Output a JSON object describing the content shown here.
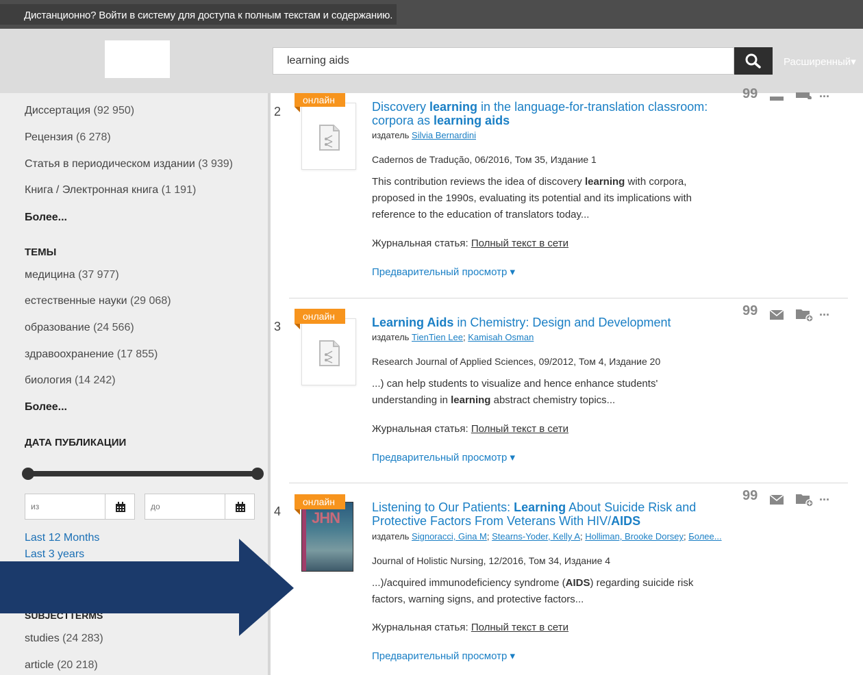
{
  "topbar": {
    "message": "Дистанционно? Войти в систему для доступа к полным текстам и содержанию."
  },
  "search": {
    "value": "learning aids",
    "advanced_label": "Расширенный"
  },
  "sidebar": {
    "content_types": [
      {
        "label": "Диссертация",
        "count": "(92 950)"
      },
      {
        "label": "Рецензия",
        "count": "(6 278)"
      },
      {
        "label": "Статья в периодическом издании",
        "count": "(3 939)"
      },
      {
        "label": "Книга / Электронная книга",
        "count": "(1 191)"
      }
    ],
    "more_1": "Более...",
    "topics_title": "ТЕМЫ",
    "topics": [
      {
        "label": "медицина",
        "count": "(37 977)"
      },
      {
        "label": "естественные науки",
        "count": "(29 068)"
      },
      {
        "label": "образование",
        "count": "(24 566)"
      },
      {
        "label": "здравоохранение",
        "count": "(17 855)"
      },
      {
        "label": "биология",
        "count": "(14 242)"
      }
    ],
    "more_2": "Более...",
    "date_title": "ДАТА ПУБЛИКАЦИИ",
    "date_from_placeholder": "из",
    "date_to_placeholder": "до",
    "quick_links": [
      "Last 12 Months",
      "Last 3 years"
    ],
    "subject_title": "SUBJECTTERMS",
    "subjects": [
      {
        "label": "studies",
        "count": "(24 283)"
      },
      {
        "label": "article",
        "count": "(20 218)"
      }
    ]
  },
  "results": [
    {
      "number": "2",
      "badge": "онлайн",
      "title_parts": [
        "Discovery ",
        "learning",
        " in the language-for-translation classroom: corpora as ",
        "learning aids"
      ],
      "authors_prefix": "издатель ",
      "authors": [
        "Silvia Bernardini"
      ],
      "source": "Cadernos de Tradução, 06/2016, Том 35, Издание 1",
      "snippet_parts": [
        "This contribution reviews the idea of discovery ",
        "learning",
        " with corpora, proposed in the 1990s, evaluating its potential and its implications with reference to the education of translators today..."
      ],
      "fulltext_prefix": "Журнальная статья: ",
      "fulltext_link": "Полный текст в сети",
      "preview": "Предварительный просмотр ▾"
    },
    {
      "number": "3",
      "badge": "онлайн",
      "title_parts": [
        "Learning Aids",
        " in Chemistry: Design and Development"
      ],
      "authors_prefix": "издатель ",
      "authors": [
        "TienTien Lee",
        "Kamisah Osman"
      ],
      "source": "Research Journal of Applied Sciences, 09/2012, Том 4, Издание 20",
      "snippet_parts": [
        "...) can help students to visualize and hence enhance students' understanding in ",
        "learning",
        " abstract chemistry topics..."
      ],
      "fulltext_prefix": "Журнальная статья: ",
      "fulltext_link": "Полный текст в сети",
      "preview": "Предварительный просмотр ▾"
    },
    {
      "number": "4",
      "badge": "онлайн",
      "cover_text": "JHN",
      "title_parts": [
        "Listening to Our Patients: ",
        "Learning",
        " About Suicide Risk and Protective Factors From Veterans With HIV/",
        "AIDS"
      ],
      "authors_prefix": "издатель ",
      "authors": [
        "Signoracci, Gina M",
        "Stearns-Yoder, Kelly A",
        "Holliman, Brooke Dorsey",
        "Более..."
      ],
      "source": "Journal of Holistic Nursing, 12/2016, Том 34, Издание 4",
      "snippet_parts": [
        "...)/acquired immunodeficiency syndrome (",
        "AIDS",
        ") regarding suicide risk factors, warning signs, and protective factors..."
      ],
      "fulltext_prefix": "Журнальная статья: ",
      "fulltext_link": "Полный текст в сети",
      "preview": "Предварительный просмотр ▾"
    }
  ],
  "action_glyphs": {
    "cite": "99",
    "more": "..."
  },
  "colors": {
    "badge": "#f7941d",
    "link": "#1a7fc5",
    "arrow": "#1b3a6b",
    "topbar": "#4d4d4d"
  }
}
